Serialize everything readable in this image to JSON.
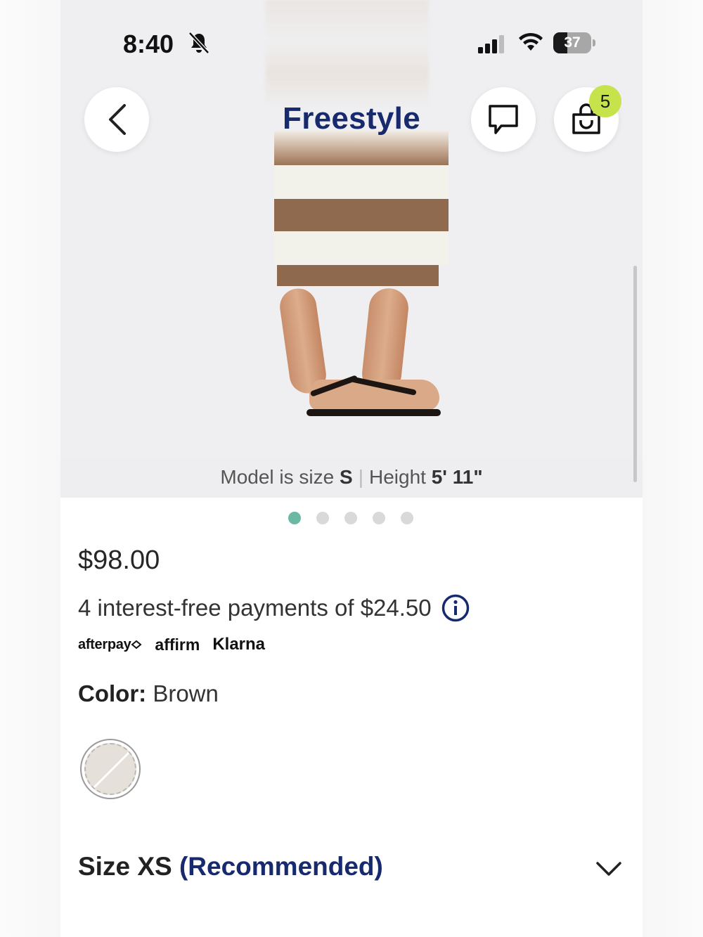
{
  "status_bar": {
    "time": "8:40",
    "battery": "37"
  },
  "header": {
    "title": "Freestyle",
    "cart_count": "5"
  },
  "gallery": {
    "caption_prefix": "Model is size",
    "model_size": "S",
    "caption_height_label": "Height",
    "model_height": "5' 11\"",
    "active_dot": 1,
    "dot_count": 5
  },
  "product": {
    "price": "$98.00",
    "installments_text": "4 interest-free payments of $24.50",
    "payment_providers": [
      "afterpay",
      "affirm",
      "Klarna"
    ],
    "color_label": "Color:",
    "color_value": "Brown",
    "size_label": "Size XS",
    "size_note": "(Recommended)"
  },
  "colors": {
    "accent": "#172a6e",
    "badge": "#c6e34b",
    "active_dot": "#6bb8a5"
  }
}
